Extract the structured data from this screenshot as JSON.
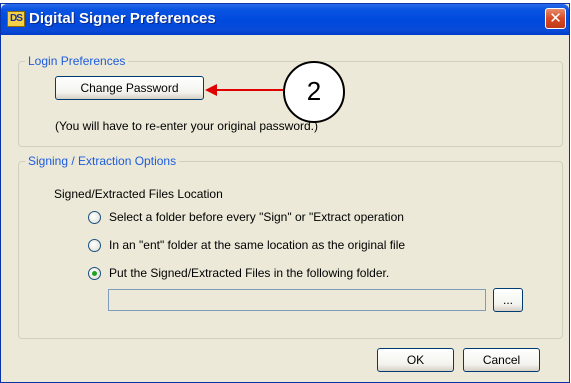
{
  "window": {
    "title": "Digital Signer Preferences",
    "close_glyph": "✕"
  },
  "login_group": {
    "legend": "Login Preferences",
    "change_password_button": "Change Password",
    "note": "(You will have to re-enter your original password.)"
  },
  "signing_group": {
    "legend": "Signing / Extraction Options",
    "location_label": "Signed/Extracted Files Location",
    "options": [
      {
        "label": "Select a folder before every \"Sign\" or \"Extract operation",
        "selected": false
      },
      {
        "label": "In an \"ent\" folder at the same location as the original file",
        "selected": false
      },
      {
        "label": "Put the Signed/Extracted Files in the following folder.",
        "selected": true
      }
    ],
    "folder_path": "",
    "browse_button": "..."
  },
  "footer": {
    "ok_button": "OK",
    "cancel_button": "Cancel"
  },
  "annotation": {
    "callout_number": "2",
    "arrow_color": "#e00000"
  },
  "colors": {
    "title_bar": "#0a54e3",
    "group_legend": "#1d5cdc",
    "dialog_bg": "#ece9d8",
    "close_button": "#d64a24"
  }
}
